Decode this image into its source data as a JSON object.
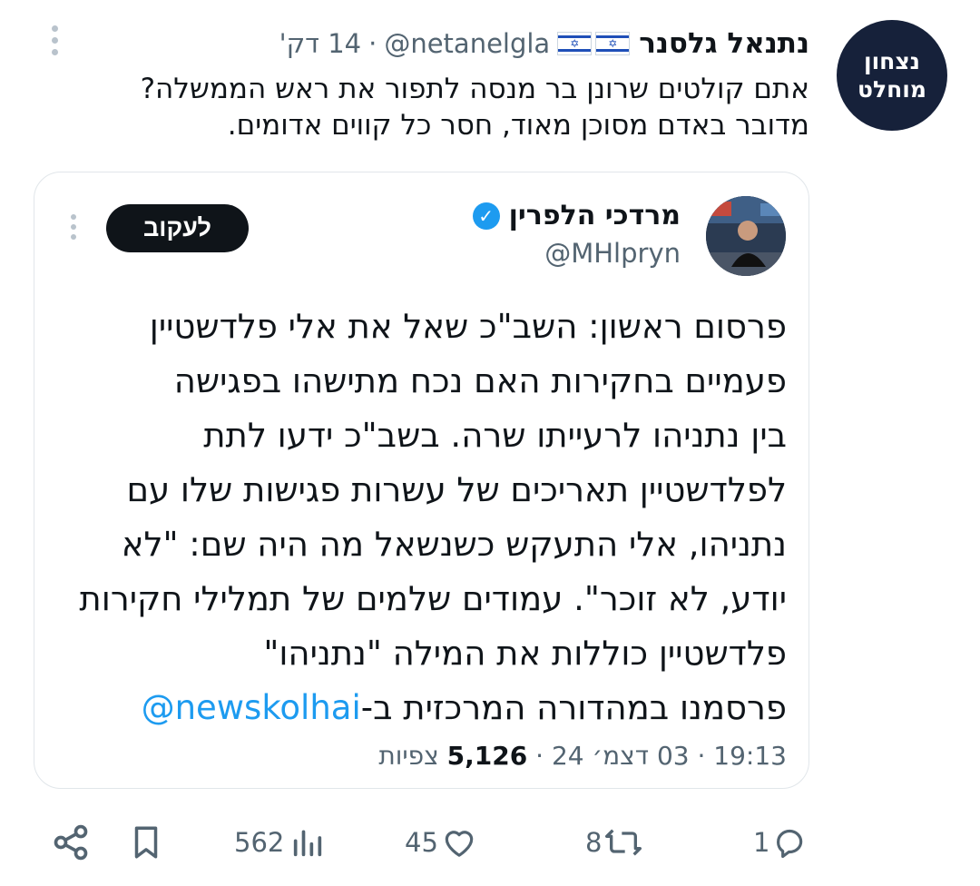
{
  "tweet": {
    "avatar_line1": "נצחון",
    "avatar_line2": "מוחלט",
    "author_name": "נתנאל גלסנר",
    "flag_icons": [
      "israel-flag-icon",
      "israel-flag-icon"
    ],
    "handle": "@netanelgla",
    "separator": "·",
    "time_ago": "14 דק'",
    "text": "אתם קולטים שרונן בר מנסה לתפור את ראש הממשלה?\nמדובר באדם מסוכן מאוד, חסר כל קווים אדומים."
  },
  "quote": {
    "author_name": "מרדכי הלפרין",
    "handle": "@MHlpryn",
    "follow_label": "לעקוב",
    "lines": [
      "פרסום ראשון: השב\"כ שאל את אלי פלדשטיין",
      "פעמיים בחקירות האם נכח מתישהו בפגישה",
      "בין נתניהו לרעייתו שרה. בשב\"כ ידעו לתת",
      "לפלדשטיין תאריכים של עשרות פגישות שלו עם",
      "נתניהו, אלי התעקש כשנשאל מה היה שם: \"לא",
      "יודע, לא זוכר\". עמודים שלמים של תמלילי חקירות",
      "פלדשטיין כוללות את המילה \"נתניהו\""
    ],
    "last_line_text": "פרסמנו במהדורה המרכזית ב-",
    "last_line_mention": "@newskolhai",
    "time": "19:13",
    "dot": "·",
    "date": "03 דצמ׳ 24",
    "views_count": "5,126",
    "views_label": "צפיות"
  },
  "actions": {
    "replies": "1",
    "reposts": "8",
    "likes": "45",
    "views": "562"
  },
  "colors": {
    "accent": "#1d9bf0",
    "muted": "#536471",
    "text": "#0f1419",
    "avatar_bg": "#16213a"
  }
}
